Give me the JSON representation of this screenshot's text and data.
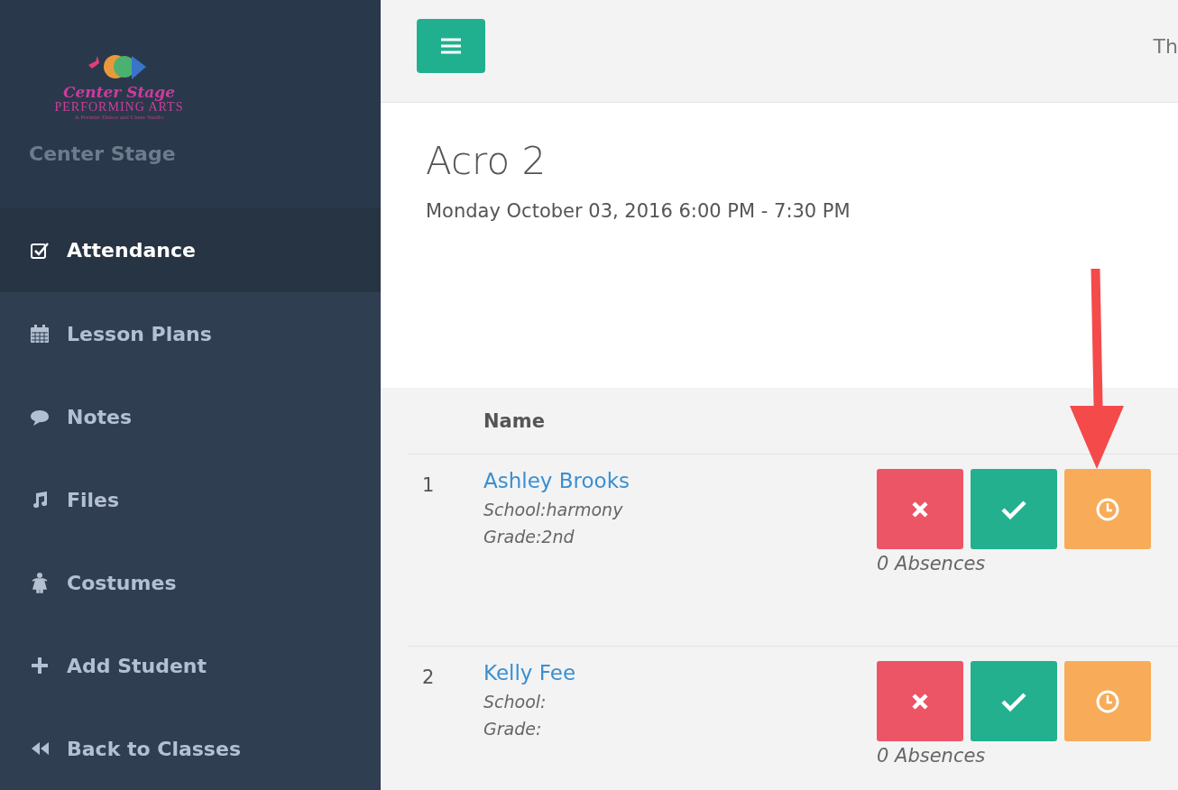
{
  "sidebar": {
    "logo": {
      "script": "Center Stage",
      "name": "PERFORMING ARTS",
      "tagline": "A Premier Dance and Cheer Studio"
    },
    "brand": "Center Stage",
    "items": [
      {
        "label": "Attendance",
        "kind": "checkbox",
        "selected": true
      },
      {
        "label": "Lesson Plans",
        "kind": "calendar",
        "selected": false
      },
      {
        "label": "Notes",
        "kind": "comment",
        "selected": false
      },
      {
        "label": "Files",
        "kind": "music",
        "selected": false
      },
      {
        "label": "Costumes",
        "kind": "dress",
        "selected": false
      },
      {
        "label": "Add Student",
        "kind": "plus",
        "selected": false
      },
      {
        "label": "Back to Classes",
        "kind": "back",
        "selected": false
      }
    ]
  },
  "topbar": {
    "right_text": "Th"
  },
  "class": {
    "title": "Acro 2",
    "schedule": "Monday October 03, 2016 6:00 PM - 7:30 PM"
  },
  "table": {
    "columns": [
      "Name"
    ],
    "rows": [
      {
        "number": "1",
        "name": "Ashley Brooks",
        "school": "School:harmony",
        "grade": "Grade:2nd",
        "absences": "0 Absences",
        "buttons": [
          {
            "kind": "absent"
          },
          {
            "kind": "present"
          },
          {
            "kind": "late"
          }
        ]
      },
      {
        "number": "2",
        "name": "Kelly Fee",
        "school": "School:",
        "grade": "Grade:",
        "absences": "0 Absences",
        "buttons": [
          {
            "kind": "absent"
          },
          {
            "kind": "present"
          },
          {
            "kind": "late"
          }
        ]
      }
    ]
  }
}
